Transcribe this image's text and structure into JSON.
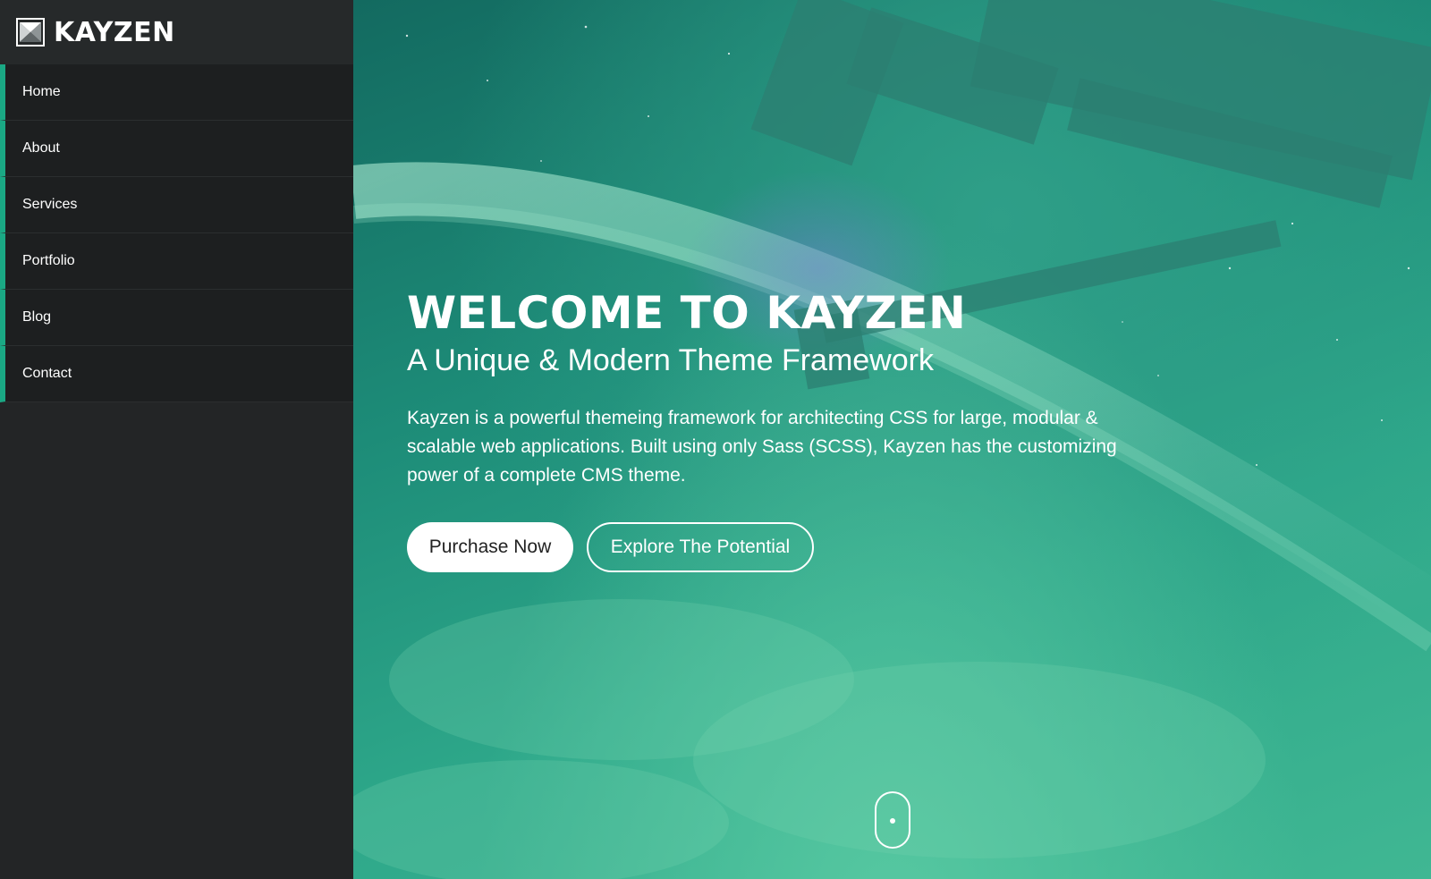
{
  "brand": {
    "name": "KAYZEN",
    "logo_icon": "kayzen-logo-icon"
  },
  "sidebar": {
    "items": [
      {
        "label": "Home"
      },
      {
        "label": "About"
      },
      {
        "label": "Services"
      },
      {
        "label": "Portfolio"
      },
      {
        "label": "Blog"
      },
      {
        "label": "Contact"
      }
    ]
  },
  "hero": {
    "title": "WELCOME TO KAYZEN",
    "subtitle": "A Unique & Modern Theme Framework",
    "text": "Kayzen is a powerful themeing framework for architecting CSS for large, modular & scalable web applications. Built using only Sass (SCSS), Kayzen has the customizing power of a complete CMS theme.",
    "buttons": {
      "primary": "Purchase Now",
      "secondary": "Explore The Potential"
    },
    "scroll_icon": "mouse-scroll-icon"
  },
  "colors": {
    "accent": "#1aa884",
    "sidebar_bg": "#232526",
    "hero_gradient": [
      "#136a60",
      "#40b793"
    ]
  }
}
